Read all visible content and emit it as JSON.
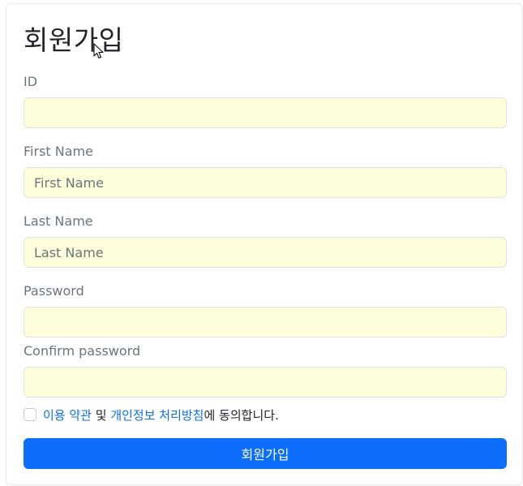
{
  "form": {
    "title": "회원가입",
    "fields": [
      {
        "label": "ID",
        "value": "",
        "placeholder": ""
      },
      {
        "label": "First Name",
        "value": "",
        "placeholder": "First Name"
      },
      {
        "label": "Last Name",
        "value": "",
        "placeholder": "Last Name"
      },
      {
        "label": "Password",
        "value": "",
        "placeholder": ""
      },
      {
        "label": "Confirm password",
        "value": "",
        "placeholder": ""
      }
    ],
    "agreement": {
      "link_terms": "이용 약관",
      "connector": " 및 ",
      "link_privacy": "개인정보 처리방침",
      "suffix": "에 동의합니다."
    },
    "submit_label": "회원가입"
  },
  "colors": {
    "accent": "#0d6efd",
    "input_bg": "#fefedb",
    "label": "#6c757d"
  },
  "icons": {
    "cursor": "mouse-pointer-icon"
  }
}
